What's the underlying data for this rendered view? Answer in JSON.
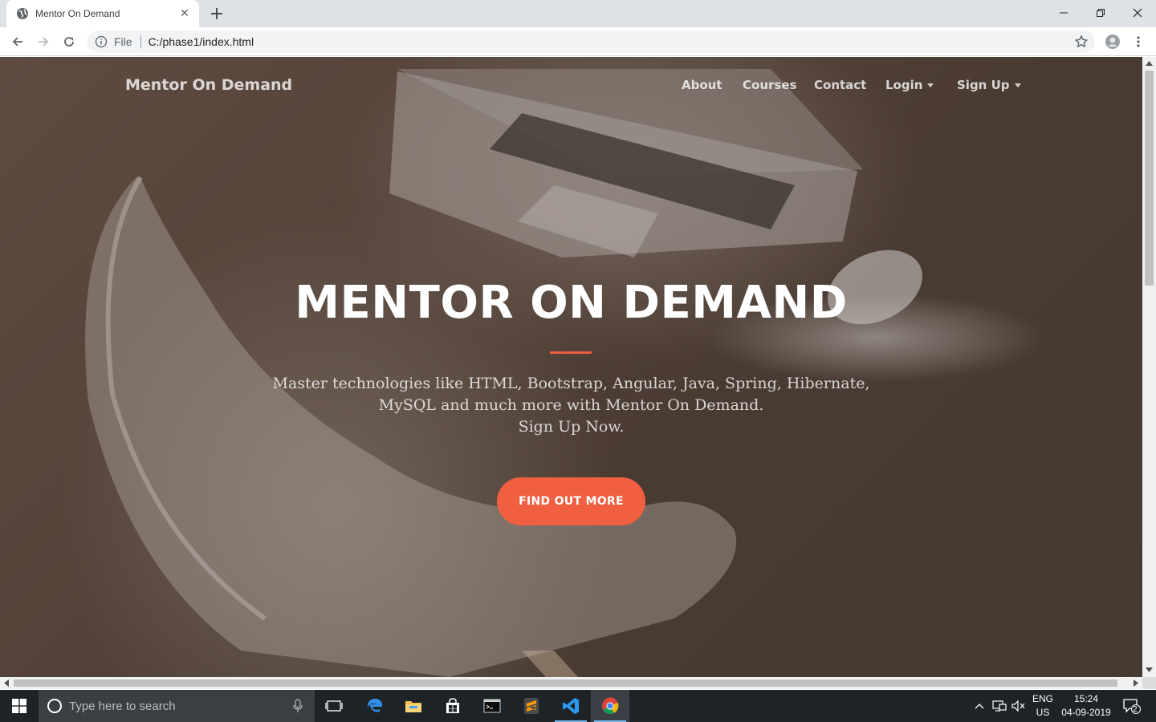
{
  "browser": {
    "tab_title": "Mentor On Demand",
    "tab_close": "✕",
    "new_tab": "+",
    "url_scheme": "File",
    "url": "C:/phase1/index.html"
  },
  "page": {
    "brand": "Mentor On Demand",
    "nav": {
      "about": "About",
      "courses": "Courses",
      "contact": "Contact",
      "login": "Login",
      "signup": "Sign Up"
    },
    "hero": {
      "title": "MENTOR ON DEMAND",
      "text_line1": "Master technologies like HTML, Bootstrap, Angular, Java, Spring, Hibernate,",
      "text_line2": "MySQL and much more with Mentor On Demand.",
      "text_line3": "Sign Up Now.",
      "button": "FIND OUT MORE"
    },
    "colors": {
      "accent": "#f05f40",
      "overlay": "#4a3b32"
    }
  },
  "taskbar": {
    "search_placeholder": "Type here to search",
    "apps": [
      "task-view",
      "edge",
      "file-explorer",
      "store",
      "terminal",
      "sublime-text",
      "vscode",
      "chrome"
    ],
    "lang_line1": "ENG",
    "lang_line2": "US",
    "time": "15:24",
    "date": "04-09-2019",
    "notification_count": "2"
  }
}
